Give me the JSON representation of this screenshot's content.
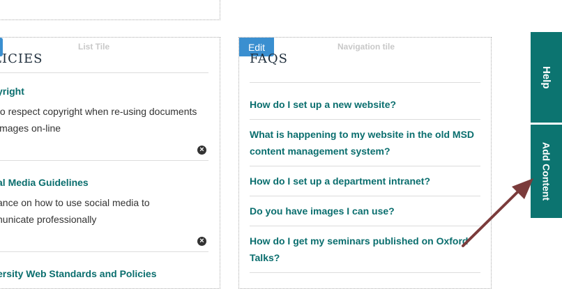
{
  "list_tile": {
    "type_label": "List Tile",
    "heading": "LICIES",
    "items": [
      {
        "title": "yright",
        "desc_lines": [
          "to respect copyright when re-using documents",
          "images on-line"
        ]
      },
      {
        "title": "al Media Guidelines",
        "desc_lines": [
          "ance on how to use social media to",
          "nunicate professionally"
        ]
      },
      {
        "title": "ersity Web Standards and Policies",
        "desc_lines": []
      }
    ]
  },
  "nav_tile": {
    "type_label": "Navigation tile",
    "edit_label": "Edit",
    "heading": "FAQS",
    "items": [
      "How do I set up a new website?",
      "What is happening to my website in the old MSD content management system?",
      "How do I set up a department intranet?",
      "Do you have images I can use?",
      "How do I get my seminars published on Oxford Talks?"
    ]
  },
  "side_tabs": {
    "help": "Help",
    "add_content": "Add Content"
  },
  "colors": {
    "accent": "#0c7470",
    "link": "#0a6e6e",
    "edit": "#3a8fd0",
    "arrow": "#7b3b3b"
  },
  "icons": {
    "remove": "remove-circle-icon",
    "arrow": "annotation-arrow"
  }
}
